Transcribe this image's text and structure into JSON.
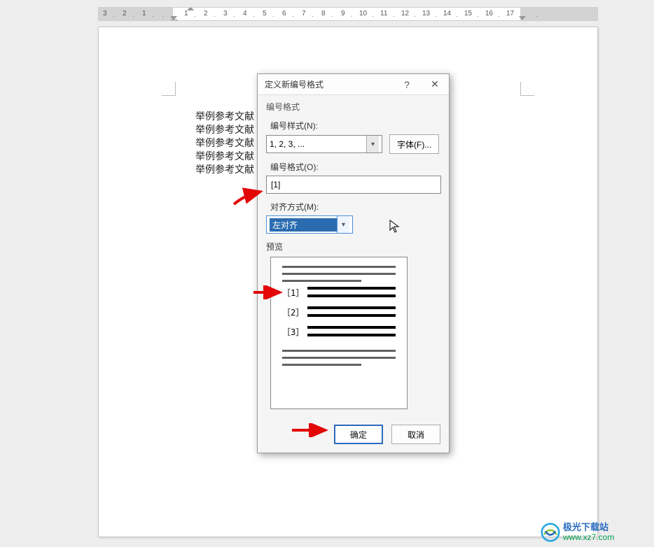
{
  "ruler": {
    "numbers": [
      "3",
      "2",
      "1",
      "1",
      "2",
      "3",
      "4",
      "5",
      "6",
      "7",
      "8",
      "9",
      "10",
      "11",
      "12",
      "13",
      "14",
      "15",
      "16",
      "17"
    ]
  },
  "document": {
    "lines": [
      "举例参考文献",
      "举例参考文献",
      "举例参考文献",
      "举例参考文献",
      "举例参考文献"
    ]
  },
  "dialog": {
    "title": "定义新编号格式",
    "help": "?",
    "close": "✕",
    "section_format": "编号格式",
    "label_style": "编号样式(N):",
    "style_value": "1, 2, 3, ...",
    "font_button": "字体(F)...",
    "label_format": "编号格式(O):",
    "format_value": "[1]",
    "label_align": "对齐方式(M):",
    "align_value": "左对齐",
    "label_preview": "预览",
    "preview_numbers": [
      "［1］",
      "［2］",
      "［3］"
    ],
    "ok": "确定",
    "cancel": "取消"
  },
  "watermark": {
    "cn": "极光下载站",
    "url": "www.xz7.com"
  }
}
